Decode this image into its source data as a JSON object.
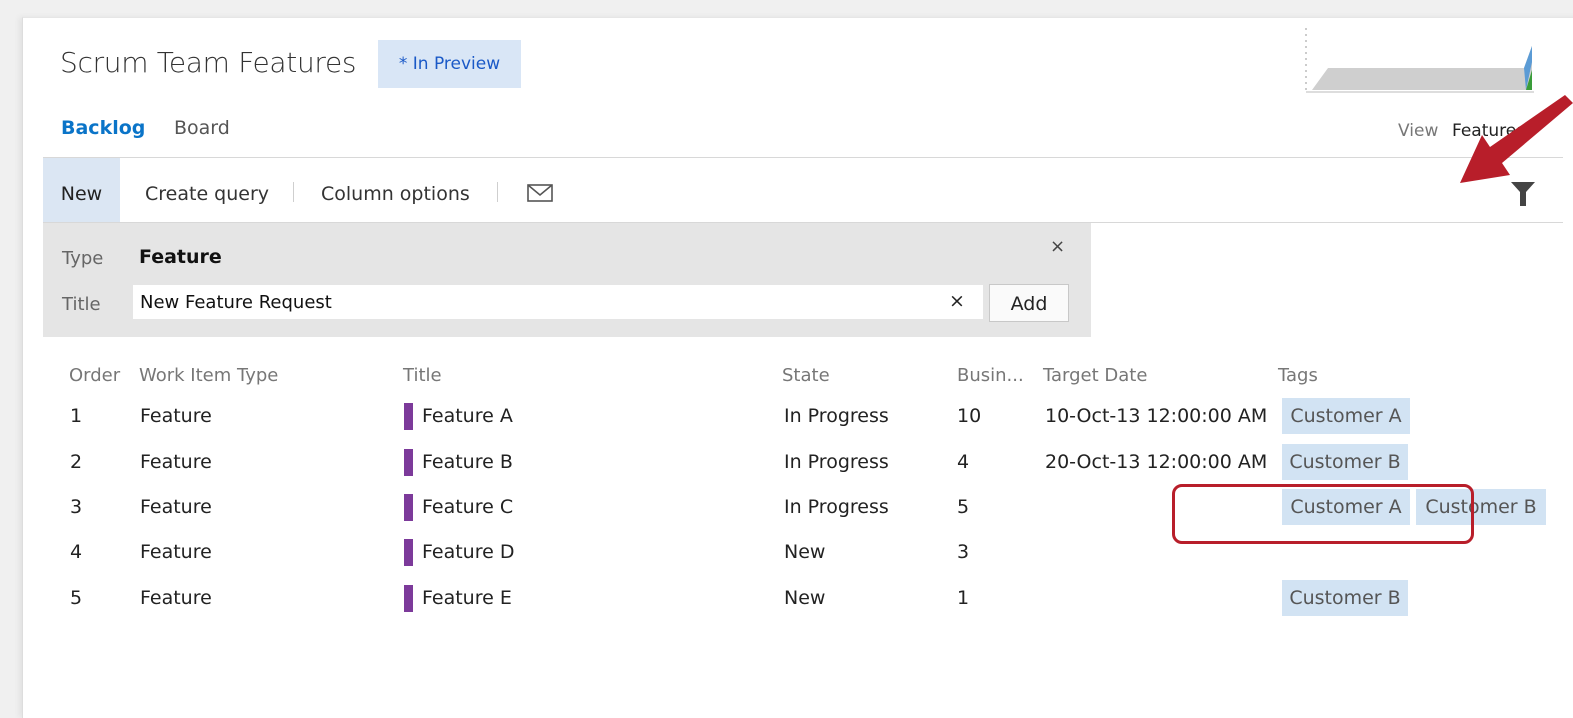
{
  "header": {
    "title": "Scrum Team Features",
    "preview_badge": "* In Preview",
    "view_label": "View",
    "view_value": "Features"
  },
  "tabs": [
    "Backlog",
    "Board"
  ],
  "toolbar": {
    "new_label": "New",
    "create_query_label": "Create query",
    "column_options_label": "Column options",
    "mail_icon": "mail-icon",
    "filter_icon": "filter-icon"
  },
  "quick_add": {
    "type_label": "Type",
    "type_value": "Feature",
    "title_label": "Title",
    "title_value": "New Feature Request",
    "clear_symbol": "×",
    "close_symbol": "×",
    "add_label": "Add"
  },
  "table": {
    "columns": [
      "Order",
      "Work Item Type",
      "Title",
      "State",
      "Busin...",
      "Target Date",
      "Tags"
    ],
    "rows": [
      {
        "order": "1",
        "type": "Feature",
        "title": "Feature A",
        "state": "In Progress",
        "business": "10",
        "target_date": "10-Oct-13 12:00:00 AM",
        "tags": [
          "Customer A"
        ]
      },
      {
        "order": "2",
        "type": "Feature",
        "title": "Feature B",
        "state": "In Progress",
        "business": "4",
        "target_date": "20-Oct-13 12:00:00 AM",
        "tags": [
          "Customer B"
        ]
      },
      {
        "order": "3",
        "type": "Feature",
        "title": "Feature C",
        "state": "In Progress",
        "business": "5",
        "target_date": "",
        "tags": [
          "Customer A",
          "Customer B"
        ]
      },
      {
        "order": "4",
        "type": "Feature",
        "title": "Feature D",
        "state": "New",
        "business": "3",
        "target_date": "",
        "tags": []
      },
      {
        "order": "5",
        "type": "Feature",
        "title": "Feature E",
        "state": "New",
        "business": "1",
        "target_date": "",
        "tags": [
          "Customer B"
        ]
      }
    ]
  },
  "colors": {
    "accent": "#0a74c8",
    "work_item_swatch": "#7c3a9a",
    "tag_bg": "#d2e3f3",
    "annotation_red": "#b81e2a"
  }
}
